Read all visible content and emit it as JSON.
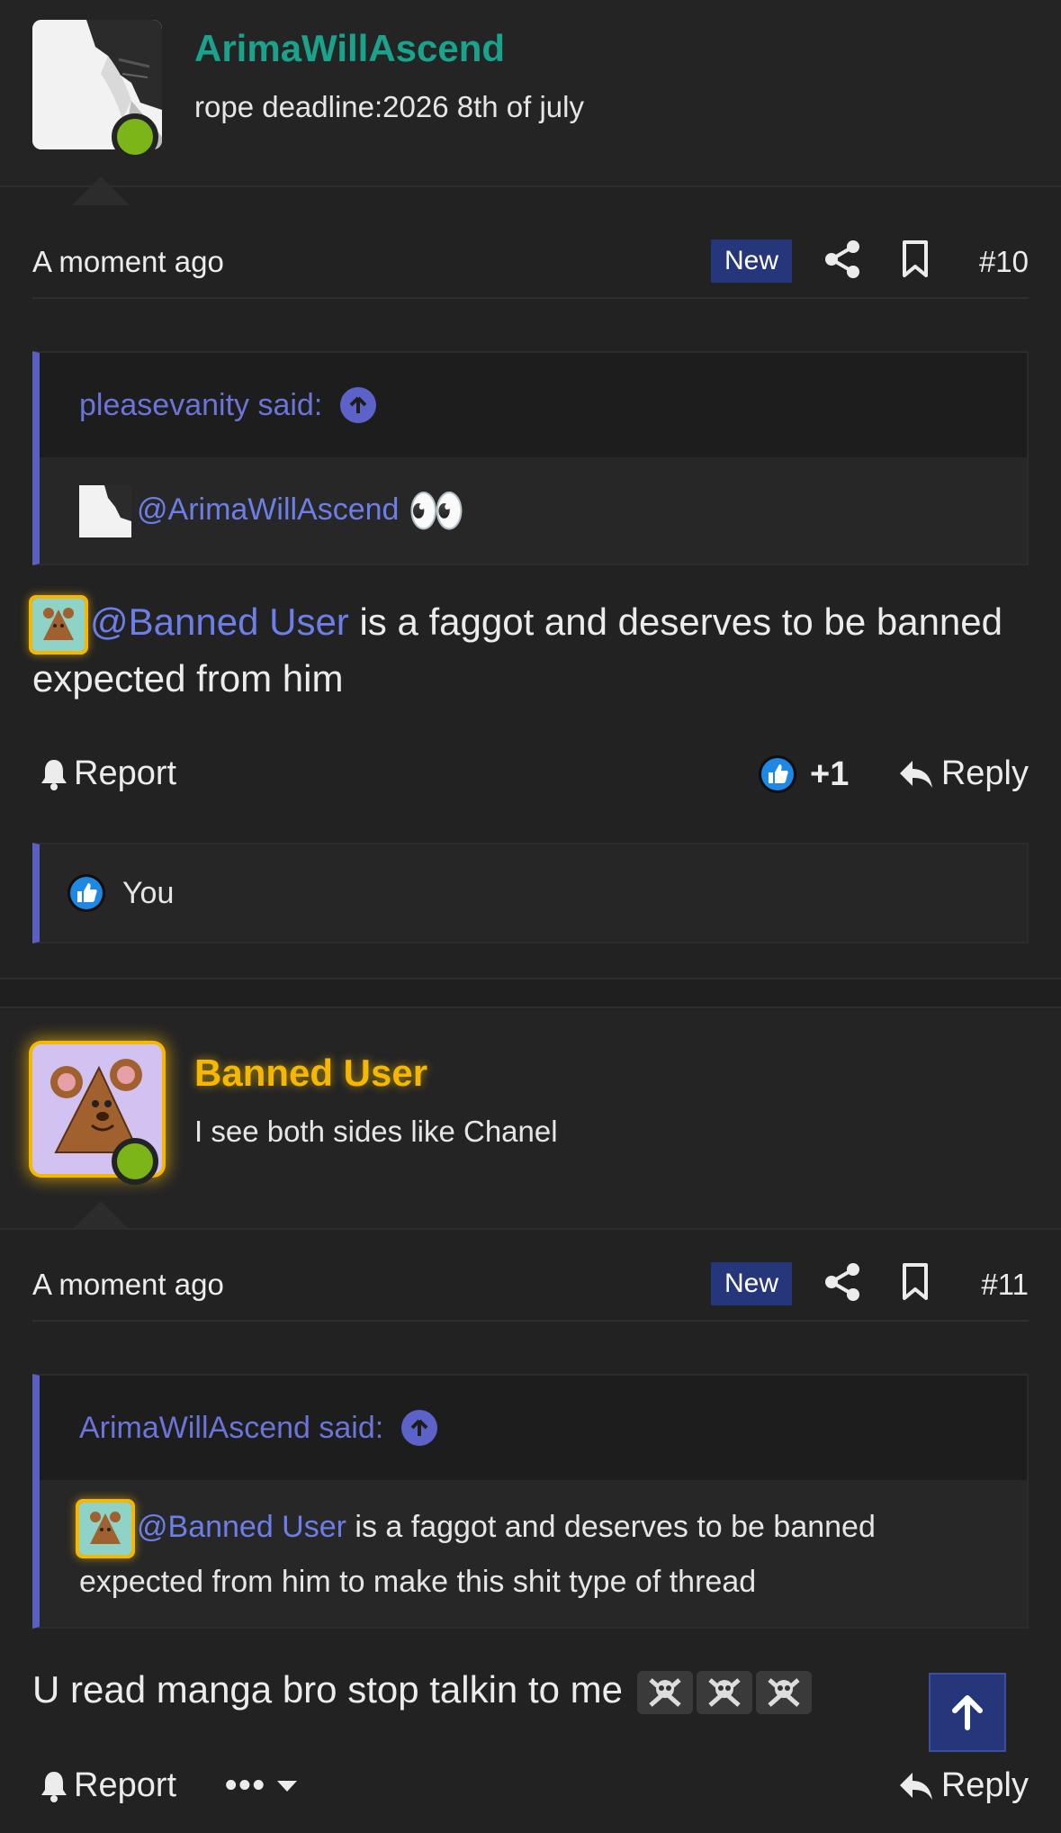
{
  "colors": {
    "background": "#222222",
    "username_teal": "#1aa38c",
    "username_gold": "#f5b700",
    "mention_blue": "#6c7ee8",
    "quote_border": "#5a5fc2",
    "new_badge_bg": "#25377a",
    "online_green": "#7cb518",
    "like_blue": "#1e88e5"
  },
  "posts": [
    {
      "username": "ArimaWillAscend",
      "user_title": "rope deadline:2026 8th of july",
      "time": "A moment ago",
      "new_label": "New",
      "number": "#10",
      "quote": {
        "author": "pleasevanity said:",
        "mention": "@ArimaWillAscend",
        "emoji": "👀"
      },
      "message": {
        "mention": "@Banned User",
        "text": " is a faggot and deserves to be banned expected from him"
      },
      "report_label": "Report",
      "reaction_count": "+1",
      "reply_label": "Reply",
      "likes_by": "You"
    },
    {
      "username": "Banned User",
      "user_title": "I see both sides like Chanel",
      "time": "A moment ago",
      "new_label": "New",
      "number": "#11",
      "quote": {
        "author": "ArimaWillAscend said:",
        "mention": "@Banned User",
        "text": " is a faggot and deserves to be banned expected from him to make this shit type of thread"
      },
      "message": {
        "text": "U read manga bro stop talkin to me"
      },
      "report_label": "Report",
      "more_label": "•••",
      "reply_label": "Reply"
    }
  ]
}
